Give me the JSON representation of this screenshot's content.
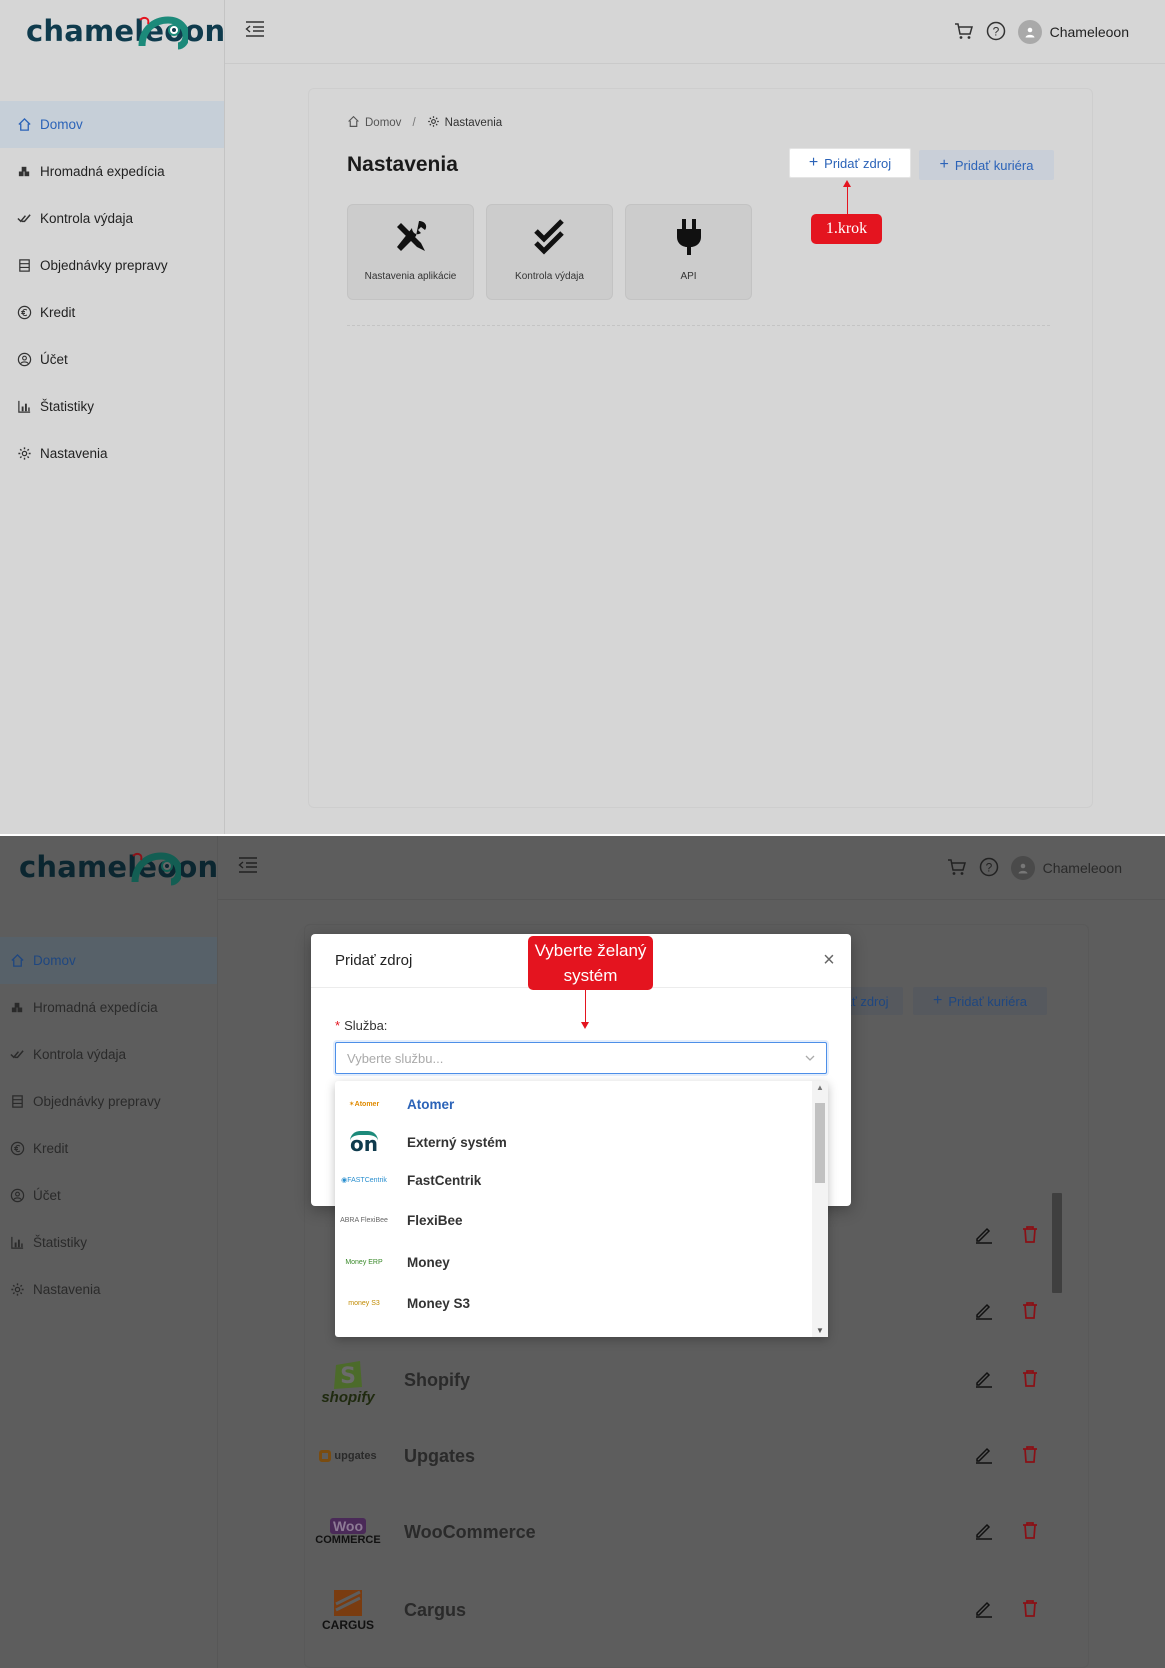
{
  "brand": {
    "logo_text": "chameleoon"
  },
  "sidebar": {
    "items": [
      {
        "label": "Domov",
        "icon": "home-icon"
      },
      {
        "label": "Hromadná expedícia",
        "icon": "boxes-icon"
      },
      {
        "label": "Kontrola výdaja",
        "icon": "double-check-icon"
      },
      {
        "label": "Objednávky prepravy",
        "icon": "list-icon"
      },
      {
        "label": "Kredit",
        "icon": "euro-icon"
      },
      {
        "label": "Účet",
        "icon": "user-circle-icon"
      },
      {
        "label": "Štatistiky",
        "icon": "bar-chart-icon"
      },
      {
        "label": "Nastavenia",
        "icon": "gear-icon"
      }
    ]
  },
  "topbar": {
    "user_name": "Chameleoon"
  },
  "breadcrumb": {
    "home": "Domov",
    "current": "Nastavenia"
  },
  "page": {
    "title": "Nastavenia",
    "add_source_label": "Pridať zdroj",
    "add_courier_label": "Pridať kuriéra",
    "tiles": [
      "Nastavenia aplikácie",
      "Kontrola výdaja",
      "API"
    ]
  },
  "annotations": {
    "step1": "1.krok",
    "step2_line1": "Vyberte želaný",
    "step2_line2": "systém"
  },
  "modal": {
    "title": "Pridať zdroj",
    "field_label": "Služba:",
    "placeholder": "Vyberte službu..."
  },
  "dropdown": {
    "options": [
      {
        "label": "Atomer",
        "logo": "Atomer"
      },
      {
        "label": "Externý systém",
        "logo": "on"
      },
      {
        "label": "FastCentrik",
        "logo": "FASTCentrik"
      },
      {
        "label": "FlexiBee",
        "logo": "ABRA FlexiBee"
      },
      {
        "label": "Money",
        "logo": "Money ERP"
      },
      {
        "label": "Money S3",
        "logo": "money S3"
      }
    ]
  },
  "background_list": {
    "rows": [
      {
        "name": "Shopify",
        "logo": "shopify"
      },
      {
        "name": "Upgates",
        "logo": "upgates"
      },
      {
        "name": "WooCommerce",
        "logo_top": "Woo",
        "logo_bottom": "COMMERCE"
      },
      {
        "name": "Cargus",
        "logo": "CARGUS"
      }
    ]
  },
  "colors": {
    "accent": "#2b63b8",
    "annotation": "#e4141f",
    "logo_teal": "#1c8a7a",
    "logo_dark": "#0f3b4d"
  }
}
